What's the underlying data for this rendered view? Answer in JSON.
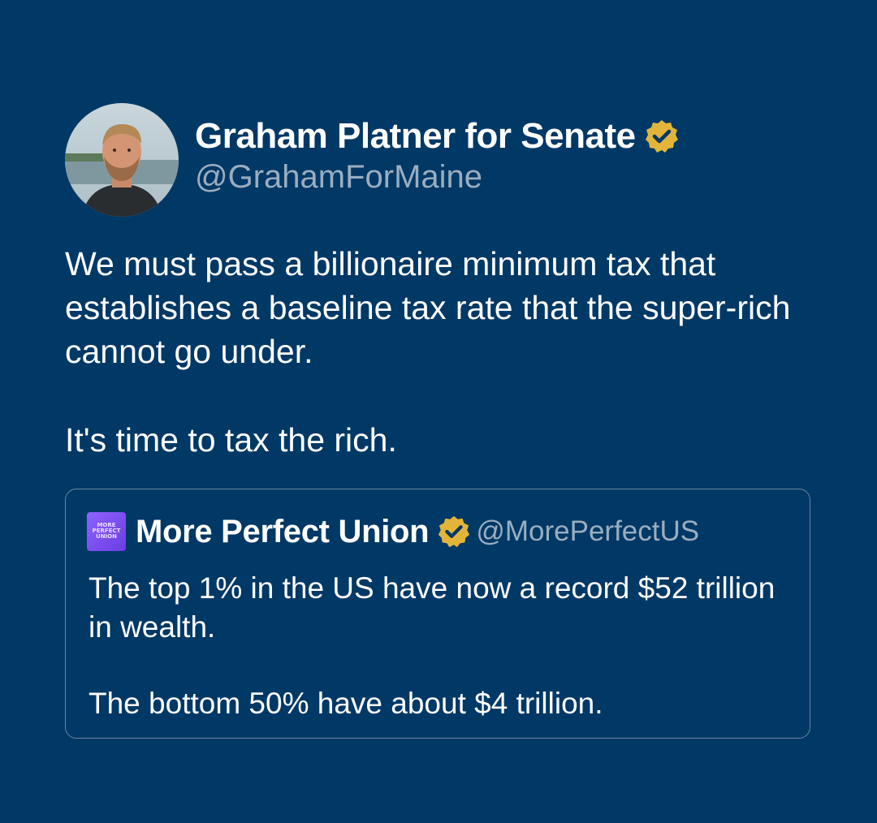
{
  "post": {
    "author": {
      "name": "Graham Platner for Senate",
      "handle": "@GrahamForMaine",
      "verified_icon": "verified-badge-icon",
      "avatar_icon": "avatar-photo"
    },
    "text": {
      "paragraph1": "We must pass a billionaire minimum tax that establishes a baseline tax rate that the super-rich cannot go under.",
      "paragraph2": "It's time to tax the rich."
    }
  },
  "quote": {
    "author": {
      "name": "More Perfect Union",
      "handle": "@MorePerfectUS",
      "logo_lines": [
        "MORE",
        "PERFECT",
        "UNION"
      ],
      "verified_icon": "verified-badge-icon"
    },
    "text": {
      "paragraph1": "The top 1% in the US have now a record $52 trillion in wealth.",
      "paragraph2": "The bottom 50% have about $4 trillion."
    }
  },
  "colors": {
    "background": "#003866",
    "badge_gold": "#e2b53a",
    "handle_gray": "#9aaebf",
    "card_border": "#6b86a3",
    "logo_purple": "#7b4cf0"
  }
}
